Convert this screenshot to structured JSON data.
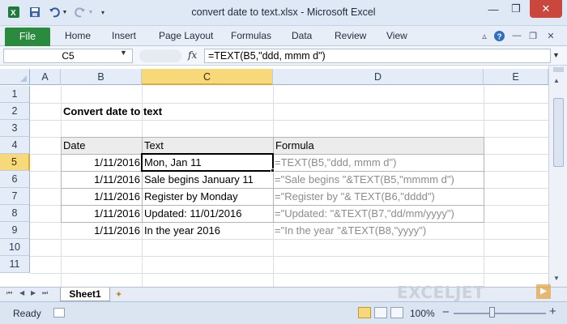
{
  "window": {
    "title": "convert date to text.xlsx - Microsoft Excel",
    "quick_access": {
      "save_icon": "save-icon",
      "undo_icon": "undo-icon",
      "redo_icon": "redo-icon"
    },
    "controls": {
      "minimize": "—",
      "restore": "❐",
      "close": "✕"
    }
  },
  "ribbon": {
    "file_label": "File",
    "tabs": [
      "Home",
      "Insert",
      "Page Layout",
      "Formulas",
      "Data",
      "Review",
      "View"
    ]
  },
  "formula_bar": {
    "name_box": "C5",
    "fx_label": "fx",
    "formula": "=TEXT(B5,\"ddd, mmm d\")"
  },
  "grid": {
    "columns": [
      "A",
      "B",
      "C",
      "D",
      "E"
    ],
    "selected_column": "C",
    "rows": [
      "1",
      "2",
      "3",
      "4",
      "5",
      "6",
      "7",
      "8",
      "9",
      "10",
      "11"
    ],
    "selected_row": "5",
    "heading": "Convert date to text",
    "table": {
      "headers": [
        "Date",
        "Text",
        "Formula"
      ],
      "rows": [
        {
          "date": "1/11/2016",
          "text": "Mon, Jan 11",
          "formula": "=TEXT(B5,\"ddd, mmm d\")"
        },
        {
          "date": "1/11/2016",
          "text": "Sale begins January 11",
          "formula": "=\"Sale begins \"&TEXT(B5,\"mmmm d\")"
        },
        {
          "date": "1/11/2016",
          "text": "Register by Monday",
          "formula": "=\"Register by \"& TEXT(B6,\"dddd\")"
        },
        {
          "date": "1/11/2016",
          "text": "Updated: 11/01/2016",
          "formula": "=\"Updated: \"&TEXT(B7,\"dd/mm/yyyy\")"
        },
        {
          "date": "1/11/2016",
          "text": "In the year 2016",
          "formula": "=\"In the year \"&TEXT(B8,\"yyyy\")"
        }
      ]
    },
    "active_cell": "C5"
  },
  "sheet_tabs": {
    "tabs": [
      "Sheet1"
    ],
    "logo_text": "EXCELJET"
  },
  "status_bar": {
    "status": "Ready",
    "zoom": "100%",
    "zoom_minus": "−",
    "zoom_plus": "+"
  },
  "colors": {
    "file_tab": "#2a8a3e",
    "selected_header": "#f7d97a"
  }
}
